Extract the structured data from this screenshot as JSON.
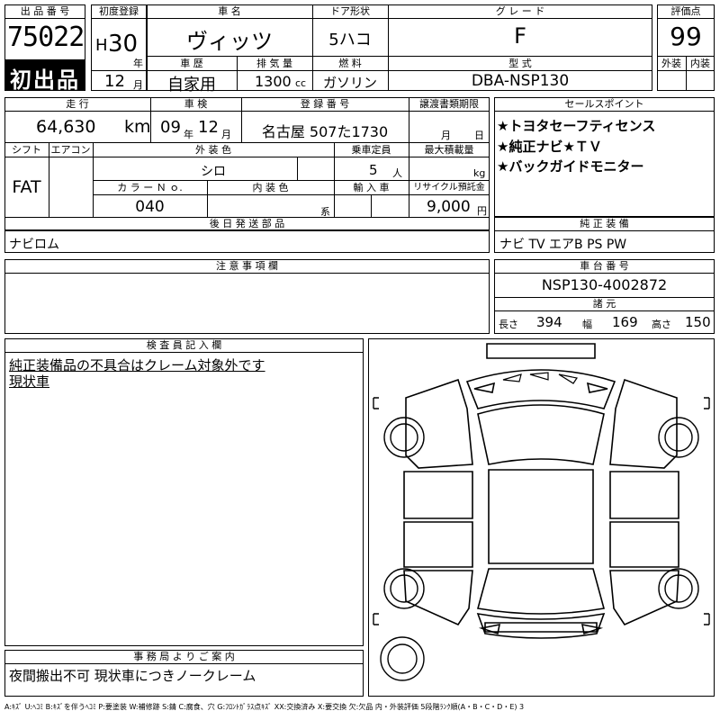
{
  "lot": {
    "header": "出 品 番 号",
    "number": "75022",
    "badge": "初出品"
  },
  "first_reg": {
    "header": "初度登録",
    "era": "H",
    "year": "30",
    "year_unit": "年",
    "month": "12",
    "month_unit": "月"
  },
  "car_name": {
    "header": "車 名",
    "value": "ヴィッツ"
  },
  "door": {
    "header": "ドア形状",
    "value": "5ハコ"
  },
  "grade": {
    "header": "グ レ ー ド",
    "value": "F"
  },
  "score": {
    "header": "評価点",
    "value": "99",
    "exterior": "外装",
    "interior": "内装"
  },
  "history": {
    "header": "車 歴",
    "value": "自家用"
  },
  "displacement": {
    "header": "排 気 量",
    "value": "1300",
    "unit": "cc"
  },
  "fuel": {
    "header": "燃 料",
    "value": "ガソリン"
  },
  "model": {
    "header": "型 式",
    "value": "DBA-NSP130"
  },
  "mileage": {
    "header": "走 行",
    "value": "64,630",
    "unit": "km"
  },
  "inspection": {
    "header": "車 検",
    "year": "09",
    "year_unit": "年",
    "month": "12",
    "month_unit": "月"
  },
  "registration": {
    "header": "登 録 番 号",
    "value": "名古屋 507た1730"
  },
  "transfer": {
    "header": "譲渡書類期限",
    "month_unit": "月",
    "day_unit": "日"
  },
  "sales": {
    "header": "セールスポイント",
    "points": [
      "★トヨタセーフティセンス",
      "★純正ナビ★ＴＶ",
      "★バックガイドモニター"
    ]
  },
  "shift": {
    "header": "シフト",
    "value": "FAT"
  },
  "aircon": {
    "header": "エアコン"
  },
  "exterior_color": {
    "header": "外 装 色",
    "value": "シロ"
  },
  "capacity": {
    "header": "乗車定員",
    "value": "5",
    "unit": "人"
  },
  "max_load": {
    "header": "最大積載量",
    "unit": "kg"
  },
  "color_no": {
    "header": "カ ラ ー Ｎ ｏ.",
    "value": "040"
  },
  "interior_color": {
    "header": "内 装 色",
    "unit": "系"
  },
  "import": {
    "header": "輸 入 車"
  },
  "recycle": {
    "header": "リサイクル預託金",
    "value": "9,000",
    "unit": "円"
  },
  "later_parts": {
    "header": "後 日 発 送 部 品",
    "value": "ナビロム"
  },
  "genuine": {
    "header": "純 正 装 備",
    "value": "ナビ TV エアB PS PW"
  },
  "notes": {
    "header": "注 意 事 項 欄"
  },
  "chassis": {
    "header": "車 台 番 号",
    "value": "NSP130-4002872"
  },
  "specs": {
    "header": "諸 元",
    "length_label": "長さ",
    "length": "394",
    "width_label": "幅",
    "width": "169",
    "height_label": "高さ",
    "height": "150"
  },
  "inspector": {
    "header": "検 査 員 記 入 欄",
    "lines": [
      "純正装備品の不具合はクレーム対象外です",
      "現状車"
    ]
  },
  "office": {
    "header": "事 務 局 よ り ご 案 内",
    "value": "夜間搬出不可 現状車につきノークレーム"
  },
  "legend": "A:ｷｽﾞ U:ﾍｺﾐ B:ｷｽﾞを伴うﾍｺﾐ P:要塗装 W:補修跡 S:錆 C:腐食、穴 G:ﾌﾛﾝﾄｶﾞﾗｽ点ｷｽﾞ XX:交換済み X:要交換 欠:欠品 内・外装評価 5段階ﾗﾝｸ順(A・B・C・D・E) 3"
}
